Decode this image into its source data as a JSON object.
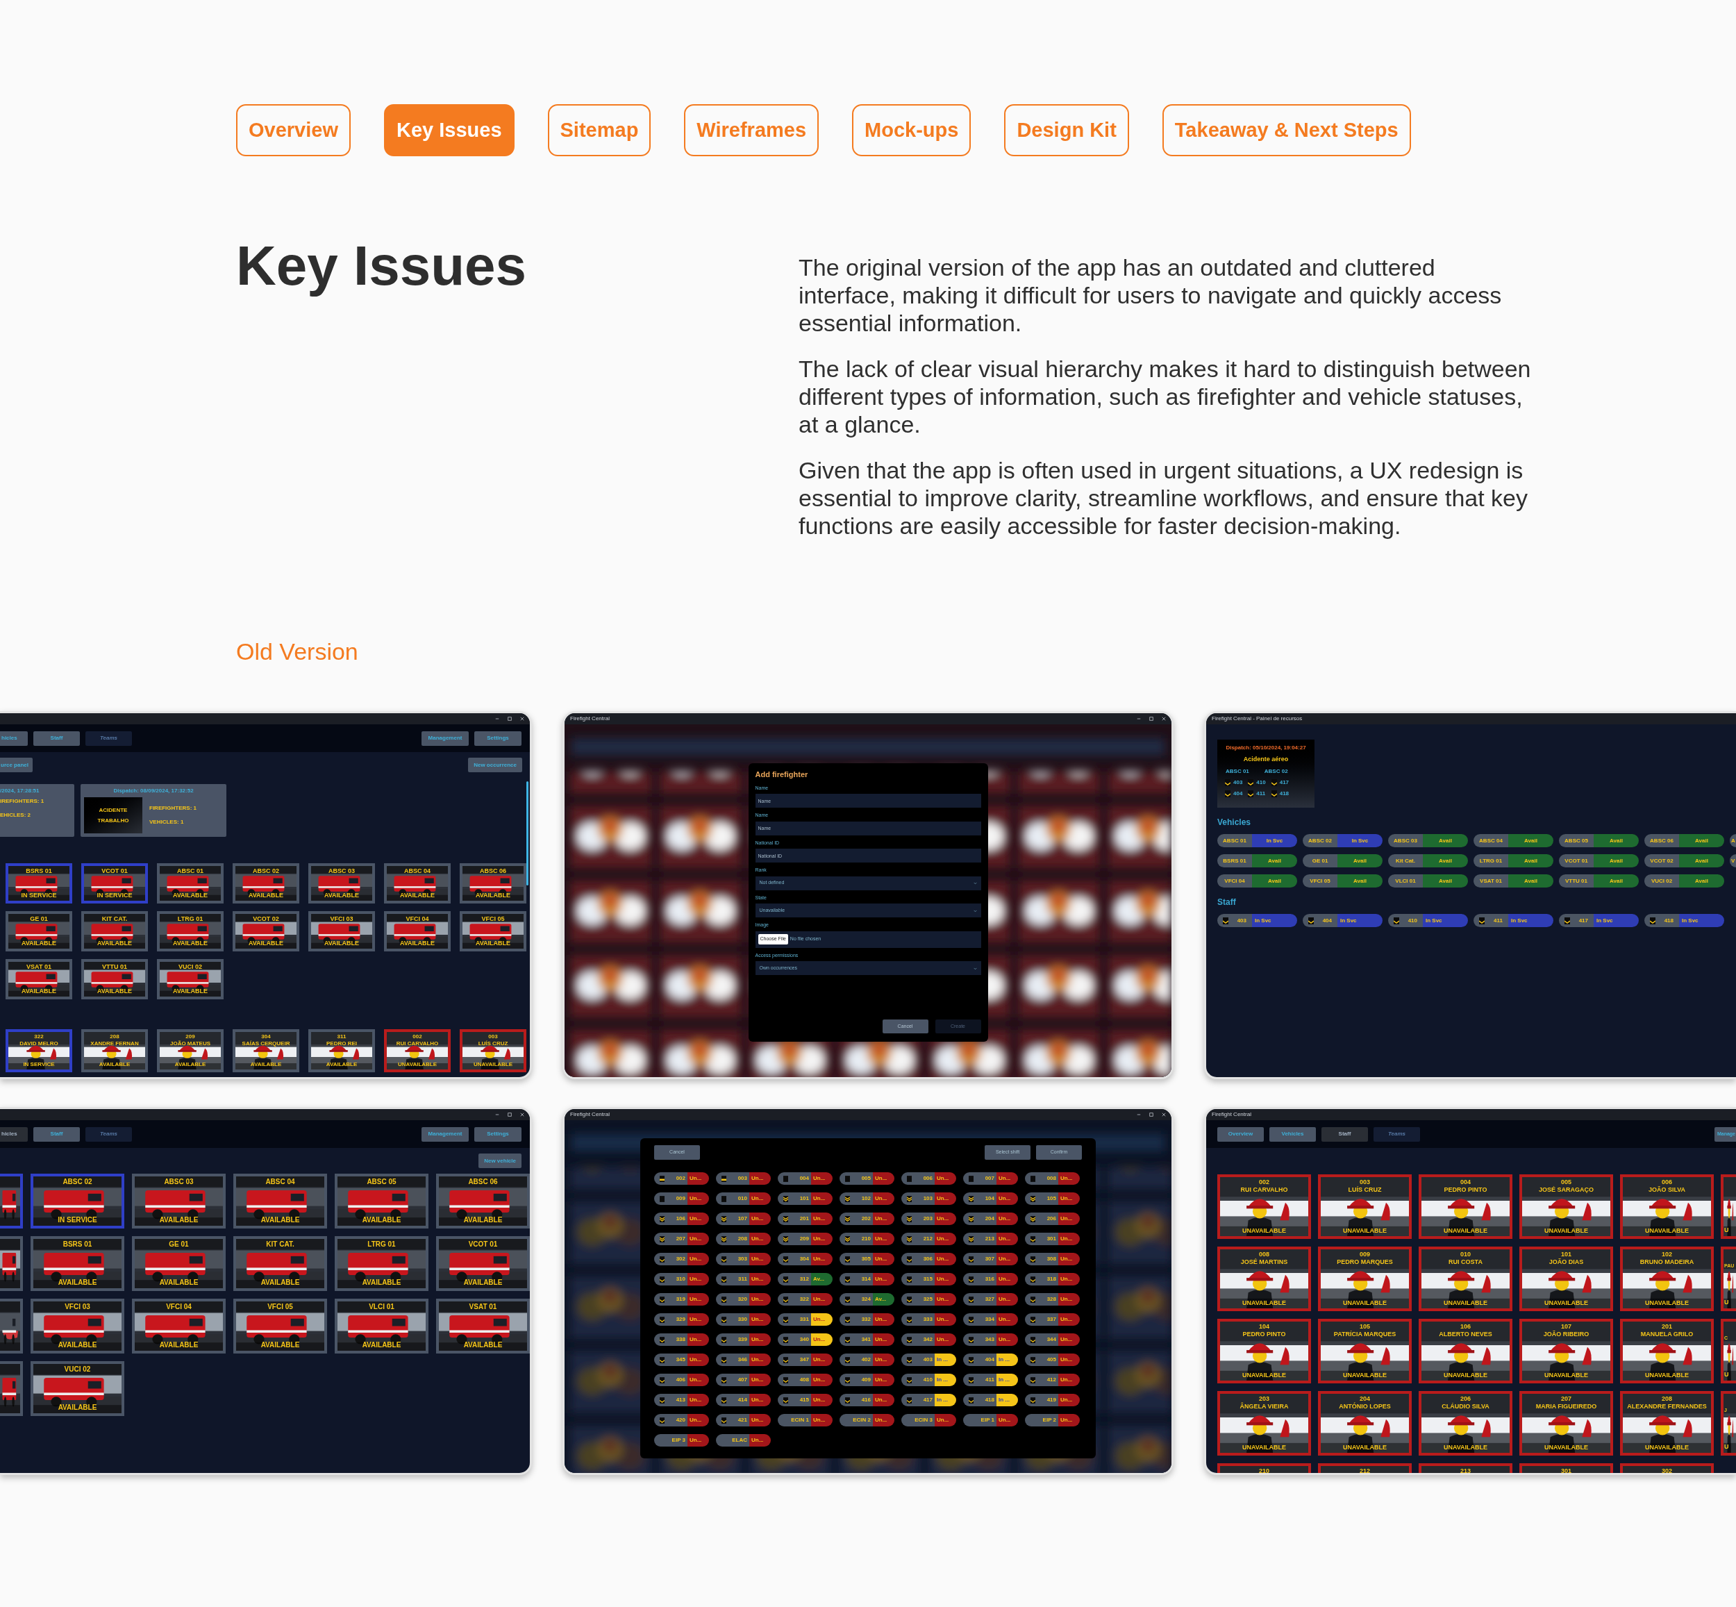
{
  "nav_tabs": [
    {
      "label": "Overview",
      "selected": false
    },
    {
      "label": "Key Issues",
      "selected": true
    },
    {
      "label": "Sitemap",
      "selected": false
    },
    {
      "label": "Wireframes",
      "selected": false
    },
    {
      "label": "Mock-ups",
      "selected": false
    },
    {
      "label": "Design Kit",
      "selected": false
    },
    {
      "label": "Takeaway & Next Steps",
      "selected": false
    }
  ],
  "heading": "Key Issues",
  "paragraphs": [
    "The original version of the app has an outdated and cluttered interface, making it difficult for users to navigate and quickly access essential information.",
    "The lack of clear visual hierarchy makes it hard to distinguish between different types of information, such as firefighter and vehicle statuses, at a glance.",
    "Given that the app is often used in urgent situations, a UX redesign is essential to improve clarity, streamline workflows, and ensure that key functions are easily accessible for faster decision-making."
  ],
  "section_label": "Old Version",
  "screenshots": [
    {
      "kind": "vehicle_board",
      "tabs": [
        {
          "label": "hicles",
          "selected": false,
          "disabled": false
        },
        {
          "label": "Staff",
          "selected": false,
          "disabled": false
        },
        {
          "label": "Teams",
          "selected": false,
          "disabled": true
        }
      ],
      "actions": [
        "Management",
        "Settings"
      ],
      "left_action": "urce panel",
      "right_action": "New occurrence",
      "occurrences": [
        {
          "dispatch": "/2024, 17:28:51",
          "firefighters": "IREFIGHTERS: 1",
          "vehicles": "EHICLES: 2"
        },
        {
          "dispatch": "Dispatch: 08/09/2024, 17:32:52",
          "type": "ACIDENTE TRABALHO",
          "firefighters": "FIREFIGHTERS: 1",
          "vehicles": "VEHICLES: 1"
        }
      ],
      "vehicles": [
        {
          "name": "BSRS 01",
          "status": "IN SERVICE",
          "kind": "in_service"
        },
        {
          "name": "VCOT 01",
          "status": "IN SERVICE",
          "kind": "in_service"
        },
        {
          "name": "ABSC 01",
          "status": "AVAILABLE",
          "kind": "available"
        },
        {
          "name": "ABSC 02",
          "status": "AVAILABLE",
          "kind": "available"
        },
        {
          "name": "ABSC 03",
          "status": "AVAILABLE",
          "kind": "available"
        },
        {
          "name": "ABSC 04",
          "status": "AVAILABLE",
          "kind": "available"
        },
        {
          "name": "ABSC 06",
          "status": "AVAILABLE",
          "kind": "available"
        },
        {
          "name": "GE 01",
          "status": "AVAILABLE",
          "kind": "available"
        },
        {
          "name": "KIT CAT.",
          "status": "AVAILABLE",
          "kind": "available"
        },
        {
          "name": "LTRG 01",
          "status": "AVAILABLE",
          "kind": "available"
        },
        {
          "name": "VCOT 02",
          "status": "AVAILABLE",
          "kind": "available"
        },
        {
          "name": "VFCI 03",
          "status": "AVAILABLE",
          "kind": "available"
        },
        {
          "name": "VFCI 04",
          "status": "AVAILABLE",
          "kind": "available"
        },
        {
          "name": "VFCI 05",
          "status": "AVAILABLE",
          "kind": "available"
        },
        {
          "name": "VSAT 01",
          "status": "AVAILABLE",
          "kind": "available"
        },
        {
          "name": "VTTU 01",
          "status": "AVAILABLE",
          "kind": "available"
        },
        {
          "name": "VUCI 02",
          "status": "AVAILABLE",
          "kind": "available"
        }
      ],
      "staff": [
        {
          "number": "322",
          "name": "DAVID MELRO",
          "status": "IN SERVICE",
          "kind": "in_service"
        },
        {
          "number": "208",
          "name": "XANDRE FERNAN",
          "status": "AVAILABLE",
          "kind": "available"
        },
        {
          "number": "209",
          "name": "JOÃO MATEUS",
          "status": "AVAILABLE",
          "kind": "available"
        },
        {
          "number": "304",
          "name": "SAÍAS CERQUEIR",
          "status": "AVAILABLE",
          "kind": "available"
        },
        {
          "number": "311",
          "name": "PEDRO REI",
          "status": "AVAILABLE",
          "kind": "available"
        },
        {
          "number": "002",
          "name": "RUI CARVALHO",
          "status": "UNAVAILABLE",
          "kind": "unavailable"
        },
        {
          "number": "003",
          "name": "LUÍS CRUZ",
          "status": "UNAVAILABLE",
          "kind": "unavailable"
        }
      ]
    },
    {
      "kind": "add_firefighter",
      "title": "Firefight Central",
      "dialog": {
        "title": "Add firefighter",
        "fields": [
          {
            "label": "Name",
            "kind": "text",
            "placeholder": "Name"
          },
          {
            "label": "Name",
            "kind": "text",
            "placeholder": "Name"
          },
          {
            "label": "National ID",
            "kind": "text",
            "placeholder": "National ID"
          },
          {
            "label": "Rank",
            "kind": "select",
            "value": "Not defined"
          },
          {
            "label": "State",
            "kind": "select",
            "value": "Unavailable"
          },
          {
            "label": "Image",
            "kind": "file",
            "button": "Choose File",
            "value": "No file chosen"
          },
          {
            "label": "Access permissions",
            "kind": "select",
            "value": "Own occurrences"
          }
        ],
        "buttons": [
          {
            "label": "Cancel",
            "disabled": false
          },
          {
            "label": "Create",
            "disabled": true
          }
        ]
      }
    },
    {
      "kind": "resource_panel",
      "title": "Firefight Central - Painel de recursos",
      "dispatch": {
        "time": "Dispatch: 05/10/2024, 19:04:27",
        "type": "Acidente aéreo",
        "vehicles": [
          "ABSC 01",
          "ABSC 02"
        ],
        "staff": [
          "403",
          "410",
          "417",
          "404",
          "411",
          "418"
        ]
      },
      "vehicles_heading": "Vehicles",
      "vehicle_rows": [
        [
          {
            "name": "ABSC 01",
            "status": "In Svc",
            "kind": "in_service"
          },
          {
            "name": "ABSC 02",
            "status": "In Svc",
            "kind": "in_service"
          },
          {
            "name": "ABSC 03",
            "status": "Avail",
            "kind": "available"
          },
          {
            "name": "ABSC 04",
            "status": "Avail",
            "kind": "available"
          },
          {
            "name": "ABSC 05",
            "status": "Avail",
            "kind": "available"
          },
          {
            "name": "ABSC 06",
            "status": "Avail",
            "kind": "available"
          },
          {
            "name": "A",
            "kind": "cut"
          }
        ],
        [
          {
            "name": "BSRS 01",
            "status": "Avail",
            "kind": "available"
          },
          {
            "name": "GE 01",
            "status": "Avail",
            "kind": "available"
          },
          {
            "name": "Kit Cat.",
            "status": "Avail",
            "kind": "available"
          },
          {
            "name": "LTRG 01",
            "status": "Avail",
            "kind": "available"
          },
          {
            "name": "VCOT 01",
            "status": "Avail",
            "kind": "available"
          },
          {
            "name": "VCOT 02",
            "status": "Avail",
            "kind": "available"
          },
          {
            "name": "V",
            "kind": "cut"
          }
        ],
        [
          {
            "name": "VFCI 04",
            "status": "Avail",
            "kind": "available"
          },
          {
            "name": "VFCI 05",
            "status": "Avail",
            "kind": "available"
          },
          {
            "name": "VLCI 01",
            "status": "Avail",
            "kind": "available"
          },
          {
            "name": "VSAT 01",
            "status": "Avail",
            "kind": "available"
          },
          {
            "name": "VTTU 01",
            "status": "Avail",
            "kind": "available"
          },
          {
            "name": "VUCI 02",
            "status": "Avail",
            "kind": "available"
          }
        ]
      ],
      "staff_heading": "Staff",
      "staff": [
        {
          "number": "403",
          "status": "In Svc",
          "kind": "in_service"
        },
        {
          "number": "404",
          "status": "In Svc",
          "kind": "in_service"
        },
        {
          "number": "410",
          "status": "In Svc",
          "kind": "in_service"
        },
        {
          "number": "411",
          "status": "In Svc",
          "kind": "in_service"
        },
        {
          "number": "417",
          "status": "In Svc",
          "kind": "in_service"
        },
        {
          "number": "418",
          "status": "In Svc",
          "kind": "in_service"
        }
      ]
    },
    {
      "kind": "vehicle_list",
      "tabs": [
        {
          "label": "hicles",
          "selected": true,
          "disabled": false
        },
        {
          "label": "Staff",
          "selected": false,
          "disabled": false
        },
        {
          "label": "Teams",
          "selected": false,
          "disabled": true
        }
      ],
      "actions": [
        "Management",
        "Settings"
      ],
      "right_action": "New vehicle",
      "cut_cards": [
        {
          "kind": "in_service"
        },
        {
          "kind": "available"
        },
        {
          "kind": "available"
        },
        {
          "kind": "available"
        }
      ],
      "vehicles": [
        {
          "name": "ABSC 02",
          "status": "IN SERVICE",
          "kind": "in_service"
        },
        {
          "name": "ABSC 03",
          "status": "AVAILABLE",
          "kind": "available"
        },
        {
          "name": "ABSC 04",
          "status": "AVAILABLE",
          "kind": "available"
        },
        {
          "name": "ABSC 05",
          "status": "AVAILABLE",
          "kind": "available"
        },
        {
          "name": "ABSC 06",
          "status": "AVAILABLE",
          "kind": "available"
        },
        {
          "name": "BSRS 01",
          "status": "AVAILABLE",
          "kind": "available"
        },
        {
          "name": "GE 01",
          "status": "AVAILABLE",
          "kind": "available"
        },
        {
          "name": "KIT CAT.",
          "status": "AVAILABLE",
          "kind": "available"
        },
        {
          "name": "LTRG 01",
          "status": "AVAILABLE",
          "kind": "available"
        },
        {
          "name": "VCOT 01",
          "status": "AVAILABLE",
          "kind": "available"
        },
        {
          "name": "VFCI 03",
          "status": "AVAILABLE",
          "kind": "available"
        },
        {
          "name": "VFCI 04",
          "status": "AVAILABLE",
          "kind": "available"
        },
        {
          "name": "VFCI 05",
          "status": "AVAILABLE",
          "kind": "available"
        },
        {
          "name": "VLCI 01",
          "status": "AVAILABLE",
          "kind": "available"
        },
        {
          "name": "VSAT 01",
          "status": "AVAILABLE",
          "kind": "available"
        },
        {
          "name": "VUCI 02",
          "status": "AVAILABLE",
          "kind": "available"
        }
      ]
    },
    {
      "kind": "shift_select",
      "title": "Firefight Central",
      "left_buttons": [
        "Cancel"
      ],
      "right_buttons": [
        "Select shift",
        "Confirm"
      ],
      "staff": [
        {
          "id": "002",
          "status": "Un...",
          "kind": "unavailable",
          "selected": false,
          "badge": {
            "kind": "stripe"
          }
        },
        {
          "id": "003",
          "status": "Un...",
          "kind": "unavailable",
          "selected": false,
          "badge": {
            "kind": "stripe"
          }
        },
        {
          "id": "004",
          "status": "Un...",
          "kind": "unavailable",
          "selected": false,
          "badge": {
            "kind": "plain"
          }
        },
        {
          "id": "005",
          "status": "Un...",
          "kind": "unavailable",
          "selected": false,
          "badge": {
            "kind": "plain"
          }
        },
        {
          "id": "006",
          "status": "Un...",
          "kind": "unavailable",
          "selected": false,
          "badge": {
            "kind": "plain"
          }
        },
        {
          "id": "007",
          "status": "Un...",
          "kind": "unavailable",
          "selected": false,
          "badge": {
            "kind": "plain"
          }
        },
        {
          "id": "008",
          "status": "Un...",
          "kind": "unavailable",
          "selected": false,
          "badge": {
            "kind": "plain"
          }
        },
        {
          "id": "009",
          "status": "Un...",
          "kind": "unavailable",
          "selected": false,
          "badge": {
            "kind": "plain"
          }
        },
        {
          "id": "010",
          "status": "Un...",
          "kind": "unavailable",
          "selected": false,
          "badge": {
            "kind": "plain"
          }
        },
        {
          "id": "101",
          "status": "Un...",
          "kind": "unavailable",
          "selected": false,
          "badge": {
            "kind": "double"
          }
        },
        {
          "id": "102",
          "status": "Un...",
          "kind": "unavailable",
          "selected": false,
          "badge": {
            "kind": "double"
          }
        },
        {
          "id": "103",
          "status": "Un...",
          "kind": "unavailable",
          "selected": false,
          "badge": {
            "kind": "double"
          }
        },
        {
          "id": "104",
          "status": "Un...",
          "kind": "unavailable",
          "selected": false,
          "badge": {
            "kind": "double"
          }
        },
        {
          "id": "105",
          "status": "Un...",
          "kind": "unavailable",
          "selected": false,
          "badge": {
            "kind": "double"
          }
        },
        {
          "id": "106",
          "status": "Un...",
          "kind": "unavailable",
          "selected": false,
          "badge": {
            "kind": "double"
          }
        },
        {
          "id": "107",
          "status": "Un...",
          "kind": "unavailable",
          "selected": false,
          "badge": {
            "kind": "double"
          }
        },
        {
          "id": "201",
          "status": "Un...",
          "kind": "unavailable",
          "selected": false,
          "badge": {
            "kind": "double"
          }
        },
        {
          "id": "202",
          "status": "Un...",
          "kind": "unavailable",
          "selected": false,
          "badge": {
            "kind": "double"
          }
        },
        {
          "id": "203",
          "status": "Un...",
          "kind": "unavailable",
          "selected": false,
          "badge": {
            "kind": "double"
          }
        },
        {
          "id": "204",
          "status": "Un...",
          "kind": "unavailable",
          "selected": false,
          "badge": {
            "kind": "double"
          }
        },
        {
          "id": "206",
          "status": "Un...",
          "kind": "unavailable",
          "selected": false,
          "badge": {
            "kind": "double"
          }
        },
        {
          "id": "207",
          "status": "Un...",
          "kind": "unavailable",
          "selected": false,
          "badge": {
            "kind": "double"
          }
        },
        {
          "id": "208",
          "status": "Un...",
          "kind": "unavailable",
          "selected": false,
          "badge": {
            "kind": "double"
          }
        },
        {
          "id": "209",
          "status": "Un...",
          "kind": "unavailable",
          "selected": false,
          "badge": {
            "kind": "double"
          }
        },
        {
          "id": "210",
          "status": "Un...",
          "kind": "unavailable",
          "selected": false,
          "badge": {
            "kind": "double"
          }
        },
        {
          "id": "212",
          "status": "Un...",
          "kind": "unavailable",
          "selected": false,
          "badge": {
            "kind": "double"
          }
        },
        {
          "id": "213",
          "status": "Un...",
          "kind": "unavailable",
          "selected": false,
          "badge": {
            "kind": "double"
          }
        },
        {
          "id": "301",
          "status": "Un...",
          "kind": "unavailable",
          "selected": false,
          "badge": {
            "kind": "single"
          }
        },
        {
          "id": "302",
          "status": "Un...",
          "kind": "unavailable",
          "selected": false,
          "badge": {
            "kind": "single"
          }
        },
        {
          "id": "303",
          "status": "Un...",
          "kind": "unavailable",
          "selected": false,
          "badge": {
            "kind": "single"
          }
        },
        {
          "id": "304",
          "status": "Un...",
          "kind": "unavailable",
          "selected": false,
          "badge": {
            "kind": "single"
          }
        },
        {
          "id": "305",
          "status": "Un...",
          "kind": "unavailable",
          "selected": false,
          "badge": {
            "kind": "single"
          }
        },
        {
          "id": "306",
          "status": "Un...",
          "kind": "unavailable",
          "selected": false,
          "badge": {
            "kind": "single"
          }
        },
        {
          "id": "307",
          "status": "Un...",
          "kind": "unavailable",
          "selected": false,
          "badge": {
            "kind": "single"
          }
        },
        {
          "id": "308",
          "status": "Un...",
          "kind": "unavailable",
          "selected": false,
          "badge": {
            "kind": "single"
          }
        },
        {
          "id": "310",
          "status": "Un...",
          "kind": "unavailable",
          "selected": false,
          "badge": {
            "kind": "single"
          }
        },
        {
          "id": "311",
          "status": "Un...",
          "kind": "unavailable",
          "selected": false,
          "badge": {
            "kind": "single"
          }
        },
        {
          "id": "312",
          "status": "Av...",
          "kind": "available",
          "selected": false,
          "badge": {
            "kind": "single"
          }
        },
        {
          "id": "314",
          "status": "Un...",
          "kind": "unavailable",
          "selected": false,
          "badge": {
            "kind": "single"
          }
        },
        {
          "id": "315",
          "status": "Un...",
          "kind": "unavailable",
          "selected": false,
          "badge": {
            "kind": "single"
          }
        },
        {
          "id": "316",
          "status": "Un...",
          "kind": "unavailable",
          "selected": false,
          "badge": {
            "kind": "single"
          }
        },
        {
          "id": "318",
          "status": "Un...",
          "kind": "unavailable",
          "selected": false,
          "badge": {
            "kind": "single"
          }
        },
        {
          "id": "319",
          "status": "Un...",
          "kind": "unavailable",
          "selected": false,
          "badge": {
            "kind": "single"
          }
        },
        {
          "id": "320",
          "status": "Un...",
          "kind": "unavailable",
          "selected": false,
          "badge": {
            "kind": "single"
          }
        },
        {
          "id": "322",
          "status": "Un...",
          "kind": "unavailable",
          "selected": false,
          "badge": {
            "kind": "single"
          }
        },
        {
          "id": "324",
          "status": "Av...",
          "kind": "available",
          "selected": false,
          "badge": {
            "kind": "single"
          }
        },
        {
          "id": "325",
          "status": "Un...",
          "kind": "unavailable",
          "selected": false,
          "badge": {
            "kind": "single"
          }
        },
        {
          "id": "327",
          "status": "Un...",
          "kind": "unavailable",
          "selected": false,
          "badge": {
            "kind": "single"
          }
        },
        {
          "id": "328",
          "status": "Un...",
          "kind": "unavailable",
          "selected": false,
          "badge": {
            "kind": "single"
          }
        },
        {
          "id": "329",
          "status": "Un...",
          "kind": "unavailable",
          "selected": false,
          "badge": {
            "kind": "single"
          }
        },
        {
          "id": "330",
          "status": "Un...",
          "kind": "unavailable",
          "selected": false,
          "badge": {
            "kind": "single"
          }
        },
        {
          "id": "331",
          "status": "Un...",
          "kind": "unavailable",
          "selected": true,
          "badge": {
            "kind": "single"
          }
        },
        {
          "id": "332",
          "status": "Un...",
          "kind": "unavailable",
          "selected": false,
          "badge": {
            "kind": "single"
          }
        },
        {
          "id": "333",
          "status": "Un...",
          "kind": "unavailable",
          "selected": false,
          "badge": {
            "kind": "single"
          }
        },
        {
          "id": "334",
          "status": "Un...",
          "kind": "unavailable",
          "selected": false,
          "badge": {
            "kind": "single"
          }
        },
        {
          "id": "337",
          "status": "Un...",
          "kind": "unavailable",
          "selected": false,
          "badge": {
            "kind": "single"
          }
        },
        {
          "id": "338",
          "status": "Un...",
          "kind": "unavailable",
          "selected": false,
          "badge": {
            "kind": "single"
          }
        },
        {
          "id": "339",
          "status": "Un...",
          "kind": "unavailable",
          "selected": false,
          "badge": {
            "kind": "single"
          }
        },
        {
          "id": "340",
          "status": "Un...",
          "kind": "unavailable",
          "selected": true,
          "badge": {
            "kind": "single"
          }
        },
        {
          "id": "341",
          "status": "Un...",
          "kind": "unavailable",
          "selected": false,
          "badge": {
            "kind": "single"
          }
        },
        {
          "id": "342",
          "status": "Un...",
          "kind": "unavailable",
          "selected": false,
          "badge": {
            "kind": "single"
          }
        },
        {
          "id": "343",
          "status": "Un...",
          "kind": "unavailable",
          "selected": false,
          "badge": {
            "kind": "single"
          }
        },
        {
          "id": "344",
          "status": "Un...",
          "kind": "unavailable",
          "selected": false,
          "badge": {
            "kind": "single"
          }
        },
        {
          "id": "345",
          "status": "Un...",
          "kind": "unavailable",
          "selected": false,
          "badge": {
            "kind": "single"
          }
        },
        {
          "id": "346",
          "status": "Un...",
          "kind": "unavailable",
          "selected": false,
          "badge": {
            "kind": "single"
          }
        },
        {
          "id": "347",
          "status": "Un...",
          "kind": "unavailable",
          "selected": false,
          "badge": {
            "kind": "single"
          }
        },
        {
          "id": "402",
          "status": "Un...",
          "kind": "unavailable",
          "selected": false,
          "badge": {
            "kind": "single"
          }
        },
        {
          "id": "403",
          "status": "In ...",
          "kind": "in_service",
          "selected": true,
          "badge": {
            "kind": "single"
          }
        },
        {
          "id": "404",
          "status": "In ...",
          "kind": "in_service",
          "selected": true,
          "badge": {
            "kind": "single"
          }
        },
        {
          "id": "405",
          "status": "Un...",
          "kind": "unavailable",
          "selected": false,
          "badge": {
            "kind": "single"
          }
        },
        {
          "id": "406",
          "status": "Un...",
          "kind": "unavailable",
          "selected": false,
          "badge": {
            "kind": "single"
          }
        },
        {
          "id": "407",
          "status": "Un...",
          "kind": "unavailable",
          "selected": false,
          "badge": {
            "kind": "single"
          }
        },
        {
          "id": "408",
          "status": "Un...",
          "kind": "unavailable",
          "selected": false,
          "badge": {
            "kind": "single"
          }
        },
        {
          "id": "409",
          "status": "Un...",
          "kind": "unavailable",
          "selected": false,
          "badge": {
            "kind": "single"
          }
        },
        {
          "id": "410",
          "status": "In ...",
          "kind": "in_service",
          "selected": true,
          "badge": {
            "kind": "single"
          }
        },
        {
          "id": "411",
          "status": "In ...",
          "kind": "in_service",
          "selected": true,
          "badge": {
            "kind": "single"
          }
        },
        {
          "id": "412",
          "status": "Un...",
          "kind": "unavailable",
          "selected": false,
          "badge": {
            "kind": "single"
          }
        },
        {
          "id": "413",
          "status": "Un...",
          "kind": "unavailable",
          "selected": false,
          "badge": {
            "kind": "single"
          }
        },
        {
          "id": "414",
          "status": "Un...",
          "kind": "unavailable",
          "selected": false,
          "badge": {
            "kind": "single"
          }
        },
        {
          "id": "415",
          "status": "Un...",
          "kind": "unavailable",
          "selected": false,
          "badge": {
            "kind": "single"
          }
        },
        {
          "id": "416",
          "status": "Un...",
          "kind": "unavailable",
          "selected": false,
          "badge": {
            "kind": "single"
          }
        },
        {
          "id": "417",
          "status": "In ...",
          "kind": "in_service",
          "selected": true,
          "badge": {
            "kind": "single"
          }
        },
        {
          "id": "418",
          "status": "In ...",
          "kind": "in_service",
          "selected": true,
          "badge": {
            "kind": "single"
          }
        },
        {
          "id": "419",
          "status": "Un...",
          "kind": "unavailable",
          "selected": false,
          "badge": {
            "kind": "single"
          }
        },
        {
          "id": "420",
          "status": "Un...",
          "kind": "unavailable",
          "selected": false,
          "badge": {
            "kind": "single"
          }
        },
        {
          "id": "421",
          "status": "Un...",
          "kind": "unavailable",
          "selected": false,
          "badge": {
            "kind": "single"
          }
        },
        {
          "id": "ECIN 1",
          "status": "Un...",
          "kind": "unavailable",
          "selected": false
        },
        {
          "id": "ECIN 2",
          "status": "Un...",
          "kind": "unavailable",
          "selected": false
        },
        {
          "id": "ECIN 3",
          "status": "Un...",
          "kind": "unavailable",
          "selected": false
        },
        {
          "id": "EIP 1",
          "status": "Un...",
          "kind": "unavailable",
          "selected": false
        },
        {
          "id": "EIP 2",
          "status": "Un...",
          "kind": "unavailable",
          "selected": false
        },
        {
          "id": "EIP 3",
          "status": "Un...",
          "kind": "unavailable",
          "selected": false
        },
        {
          "id": "ELAC",
          "status": "Un...",
          "kind": "unavailable",
          "selected": false
        }
      ]
    },
    {
      "kind": "staff_list",
      "title": "Firefight Central",
      "tabs": [
        {
          "label": "Overview",
          "selected": false,
          "disabled": false
        },
        {
          "label": "Vehicles",
          "selected": false,
          "disabled": false
        },
        {
          "label": "Staff",
          "selected": true,
          "disabled": false
        },
        {
          "label": "Teams",
          "selected": false,
          "disabled": true
        }
      ],
      "actions": [
        "Manage"
      ],
      "staff": [
        {
          "number": "002",
          "name": "RUI CARVALHO",
          "status": "UNAVAILABLE",
          "kind": "unavailable"
        },
        {
          "number": "003",
          "name": "LUÍS CRUZ",
          "status": "UNAVAILABLE",
          "kind": "unavailable"
        },
        {
          "number": "004",
          "name": "PEDRO PINTO",
          "status": "UNAVAILABLE",
          "kind": "unavailable"
        },
        {
          "number": "005",
          "name": "JOSÉ SARAGAÇO",
          "status": "UNAVAILABLE",
          "kind": "unavailable"
        },
        {
          "number": "006",
          "name": "JOÃO SILVA",
          "status": "UNAVAILABLE",
          "kind": "unavailable"
        },
        {
          "kind": "cut",
          "status": "U"
        },
        {
          "number": "008",
          "name": "JOSÉ MARTINS",
          "status": "UNAVAILABLE",
          "kind": "unavailable"
        },
        {
          "number": "009",
          "name": "PEDRO MARQUES",
          "status": "UNAVAILABLE",
          "kind": "unavailable"
        },
        {
          "number": "010",
          "name": "RUI COSTA",
          "status": "UNAVAILABLE",
          "kind": "unavailable"
        },
        {
          "number": "101",
          "name": "JOÃO DIAS",
          "status": "UNAVAILABLE",
          "kind": "unavailable"
        },
        {
          "number": "102",
          "name": "BRUNO MADEIRA",
          "status": "UNAVAILABLE",
          "kind": "unavailable"
        },
        {
          "kind": "cut",
          "name": "PAU",
          "status": "U"
        },
        {
          "number": "104",
          "name": "PEDRO PINTO",
          "status": "UNAVAILABLE",
          "kind": "unavailable"
        },
        {
          "number": "105",
          "name": "PATRÍCIA MARQUES",
          "status": "UNAVAILABLE",
          "kind": "unavailable"
        },
        {
          "number": "106",
          "name": "ALBERTO NEVES",
          "status": "UNAVAILABLE",
          "kind": "unavailable"
        },
        {
          "number": "107",
          "name": "JOÃO RIBEIRO",
          "status": "UNAVAILABLE",
          "kind": "unavailable"
        },
        {
          "number": "201",
          "name": "MANUELA GRILO",
          "status": "UNAVAILABLE",
          "kind": "unavailable"
        },
        {
          "kind": "cut",
          "name": "C",
          "status": "U"
        },
        {
          "number": "203",
          "name": "ÂNGELA VIEIRA",
          "status": "UNAVAILABLE",
          "kind": "unavailable"
        },
        {
          "number": "204",
          "name": "ANTÓNIO LOPES",
          "status": "UNAVAILABLE",
          "kind": "unavailable"
        },
        {
          "number": "206",
          "name": "CLÁUDIO SILVA",
          "status": "UNAVAILABLE",
          "kind": "unavailable"
        },
        {
          "number": "207",
          "name": "MARIA FIGUEIREDO",
          "status": "UNAVAILABLE",
          "kind": "unavailable"
        },
        {
          "number": "208",
          "name": "ALEXANDRE FERNANDES",
          "status": "UNAVAILABLE",
          "kind": "unavailable"
        },
        {
          "kind": "cut",
          "name": "J",
          "status": "U"
        },
        {
          "number": "210",
          "kind": "unavailable"
        },
        {
          "number": "212",
          "kind": "unavailable"
        },
        {
          "number": "213",
          "kind": "unavailable"
        },
        {
          "number": "301",
          "kind": "unavailable"
        },
        {
          "number": "302",
          "kind": "unavailable"
        }
      ]
    }
  ]
}
